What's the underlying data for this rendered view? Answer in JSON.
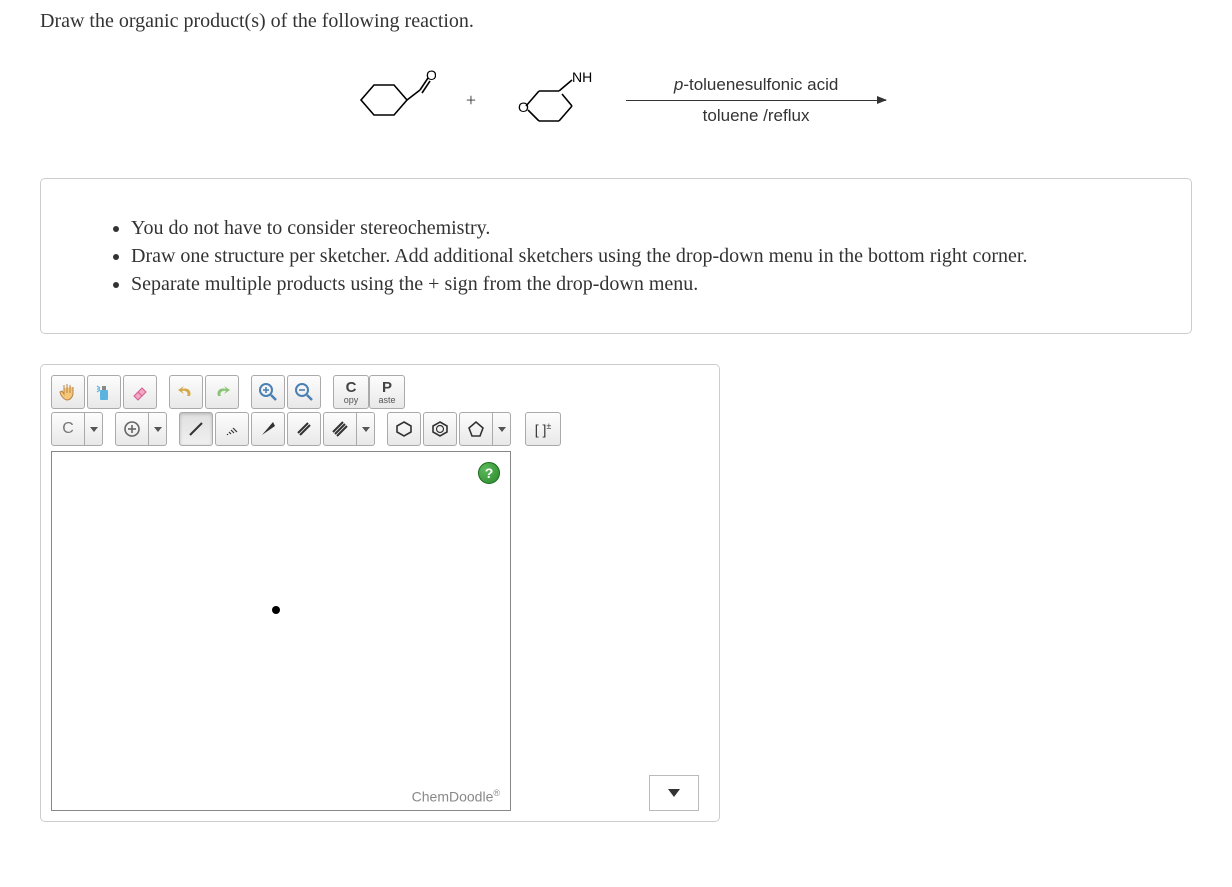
{
  "question": "Draw the organic product(s) of the following reaction.",
  "reaction": {
    "plus_sign": "+",
    "reagent2_label": "NH",
    "arrow_top_italic": "p",
    "arrow_top_rest": "-toluenesulfonic acid",
    "arrow_bottom": "toluene /reflux"
  },
  "instructions": [
    "You do not have to consider stereochemistry.",
    "Draw one structure per sketcher. Add additional sketchers using the drop-down menu in the bottom right corner.",
    "Separate multiple products using the + sign from the drop-down menu."
  ],
  "toolbar": {
    "element_label": "C",
    "copy_big": "C",
    "copy_small": "opy",
    "paste_big": "P",
    "paste_small": "aste",
    "charge_label": "[ ]",
    "charge_sup": "±",
    "help": "?",
    "brand": "ChemDoodle",
    "brand_mark": "®"
  }
}
